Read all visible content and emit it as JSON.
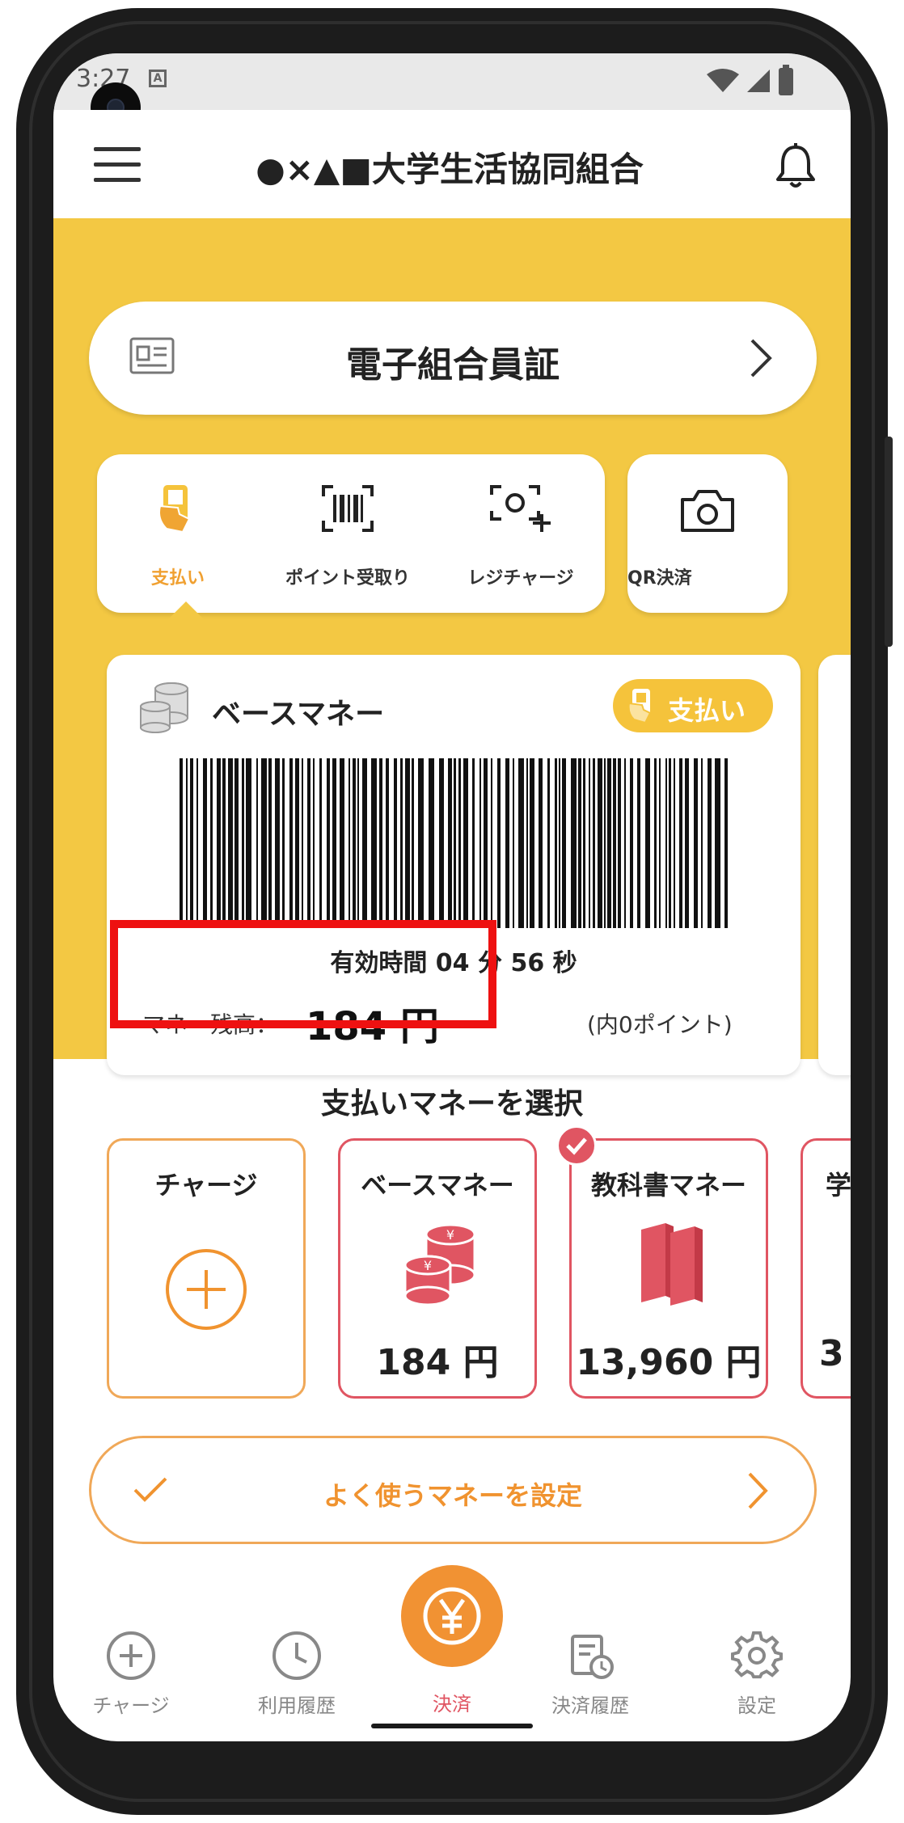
{
  "status_bar": {
    "time": "3:27",
    "badge": "A"
  },
  "header": {
    "title": "●×▲■大学生活協同組合",
    "menu_icon": "hamburger-icon",
    "bell_icon": "bell-icon"
  },
  "member_card": {
    "label": "電子組合員証"
  },
  "actions": [
    {
      "label": "支払い",
      "icon": "pay-hand-icon",
      "selected": true
    },
    {
      "label": "ポイント受取り",
      "icon": "barcode-scan-icon",
      "selected": false
    },
    {
      "label": "レジチャージ",
      "icon": "register-charge-icon",
      "selected": false
    }
  ],
  "qr": {
    "label": "QR決済"
  },
  "pay_card": {
    "name": "ベースマネー",
    "pay_badge": "支払い",
    "timer": "有効時間 04 分 56 秒",
    "balance_label": "マネー残高：",
    "balance_amount": "184 円",
    "points_note": "(内0ポイント)"
  },
  "money_select": {
    "title": "支払いマネーを選択",
    "charge_label": "チャージ",
    "cards": [
      {
        "name": "ベースマネー",
        "amount": "184 円",
        "icon": "coin-stack-icon",
        "checked": false
      },
      {
        "name": "教科書マネー",
        "amount": "13,960 円",
        "icon": "books-icon",
        "checked": true
      },
      {
        "name": "学",
        "amount": "3",
        "icon": "",
        "checked": false
      }
    ]
  },
  "favorite": {
    "label": "よく使うマネーを設定"
  },
  "nav": [
    {
      "label": "チャージ",
      "icon": "plus-circle-icon"
    },
    {
      "label": "利用履歴",
      "icon": "clock-icon"
    },
    {
      "label": "決済",
      "icon": "yen-icon",
      "active": true
    },
    {
      "label": "決済履歴",
      "icon": "receipt-history-icon"
    },
    {
      "label": "設定",
      "icon": "gear-icon"
    }
  ],
  "colors": {
    "yellow": "#f3c843",
    "orange": "#f19233",
    "red": "#e05562",
    "highlight": "#ee1111"
  }
}
